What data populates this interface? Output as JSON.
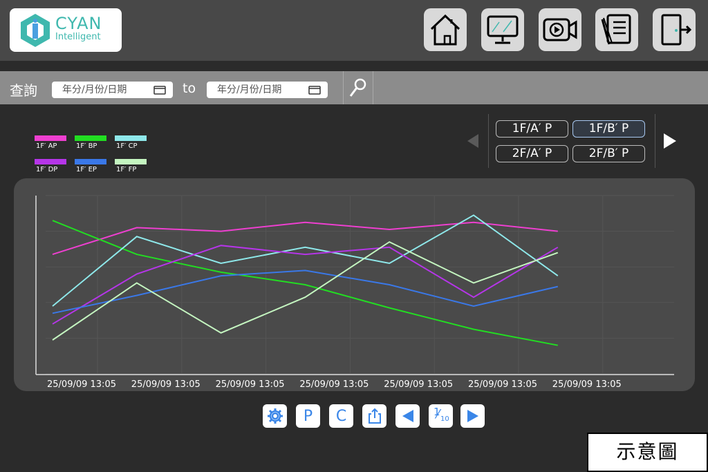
{
  "brand": {
    "name": "CYAN",
    "sub": "Intelligent"
  },
  "nav": [
    {
      "name": "home-icon"
    },
    {
      "name": "monitor-icon"
    },
    {
      "name": "video-icon"
    },
    {
      "name": "report-icon"
    },
    {
      "name": "logout-icon"
    }
  ],
  "query": {
    "label": "查詢",
    "start_placeholder": "年分/月份/日期",
    "to": "to",
    "end_placeholder": "年分/月份/日期"
  },
  "floors": [
    {
      "label": "1F/A′ P",
      "active": false
    },
    {
      "label": "1F/B′ P",
      "active": true
    },
    {
      "label": "2F/A′ P",
      "active": false
    },
    {
      "label": "2F/B′ P",
      "active": false
    }
  ],
  "toolbar": {
    "p_label": "P",
    "c_label": "C",
    "page_num": "1",
    "page_den": "10"
  },
  "caption": "示意圖",
  "chart_data": {
    "type": "line",
    "title": "",
    "xlabel": "",
    "ylabel": "",
    "ylim": [
      0,
      100
    ],
    "grid": true,
    "legend_position": "top-left",
    "categories": [
      "25/09/09 13:05",
      "25/09/09 13:05",
      "25/09/09 13:05",
      "25/09/09 13:05",
      "25/09/09 13:05",
      "25/09/09 13:05",
      "25/09/09 13:05"
    ],
    "series": [
      {
        "name": "1F′ AP",
        "color": "#ee3fd0",
        "values": [
          67,
          82,
          80,
          85,
          81,
          85,
          80
        ]
      },
      {
        "name": "1F′ BP",
        "color": "#22dd22",
        "values": [
          86,
          67,
          57,
          50,
          37,
          25,
          16
        ]
      },
      {
        "name": "1F′ CP",
        "color": "#8ee8ea",
        "values": [
          38,
          77,
          62,
          71,
          62,
          89,
          55
        ]
      },
      {
        "name": "1F′ DP",
        "color": "#b535e8",
        "values": [
          28,
          56,
          72,
          67,
          71,
          43,
          71
        ]
      },
      {
        "name": "1F′ EP",
        "color": "#3a78e8",
        "values": [
          34,
          44,
          55,
          58,
          50,
          38,
          49
        ]
      },
      {
        "name": "1F′ FP",
        "color": "#c4f5c0",
        "values": [
          19,
          51,
          23,
          43,
          74,
          51,
          68
        ]
      }
    ]
  }
}
